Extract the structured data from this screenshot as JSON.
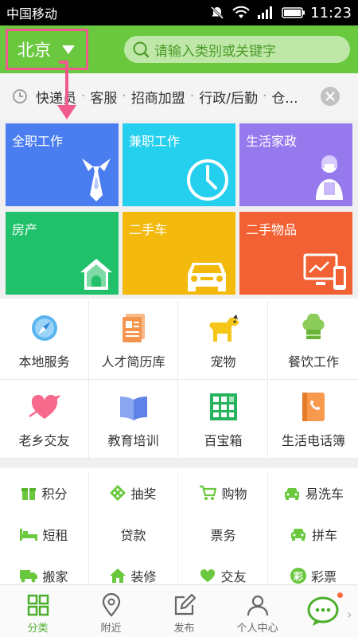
{
  "status": {
    "carrier": "中国移动",
    "time": "11:23"
  },
  "header": {
    "city": "北京",
    "search_placeholder": "请输入类别或关键字"
  },
  "history": {
    "items": [
      "快递员",
      "客服",
      "招商加盟",
      "行政/后勤",
      "仓..."
    ],
    "separator": "·"
  },
  "tiles": [
    {
      "label": "全职工作",
      "color": "#4a7df0",
      "icon": "tie-icon"
    },
    {
      "label": "兼职工作",
      "color": "#25cfee",
      "icon": "clock-icon"
    },
    {
      "label": "生活家政",
      "color": "#9779ee",
      "icon": "maid-icon"
    },
    {
      "label": "房产",
      "color": "#21c16b",
      "icon": "house-icon"
    },
    {
      "label": "二手车",
      "color": "#f3b90d",
      "icon": "car-icon"
    },
    {
      "label": "二手物品",
      "color": "#f26133",
      "icon": "devices-icon"
    }
  ],
  "grid": [
    {
      "label": "本地服务",
      "icon": "compass-icon"
    },
    {
      "label": "人才简历库",
      "icon": "resume-icon"
    },
    {
      "label": "宠物",
      "icon": "dog-icon"
    },
    {
      "label": "餐饮工作",
      "icon": "chef-hat-icon"
    },
    {
      "label": "老乡交友",
      "icon": "heart-arrow-icon"
    },
    {
      "label": "教育培训",
      "icon": "book-icon"
    },
    {
      "label": "百宝箱",
      "icon": "grid-box-icon"
    },
    {
      "label": "生活电话簿",
      "icon": "phonebook-icon"
    }
  ],
  "list": [
    {
      "label": "积分",
      "icon": "gift-icon"
    },
    {
      "label": "抽奖",
      "icon": "lottery-icon"
    },
    {
      "label": "购物",
      "icon": "cart-icon"
    },
    {
      "label": "易洗车",
      "icon": "carwash-icon"
    },
    {
      "label": "短租",
      "icon": "bed-icon"
    },
    {
      "label": "贷款",
      "icon": ""
    },
    {
      "label": "票务",
      "icon": ""
    },
    {
      "label": "拼车",
      "icon": "carpool-icon"
    },
    {
      "label": "搬家",
      "icon": "truck-icon"
    },
    {
      "label": "装修",
      "icon": "home-icon"
    },
    {
      "label": "交友",
      "icon": "heart-icon"
    },
    {
      "label": "彩票",
      "icon": "lottery-ticket-icon"
    }
  ],
  "list_lottery_char": "彩",
  "tabs": [
    {
      "label": "分类",
      "icon": "category-icon",
      "active": true
    },
    {
      "label": "附近",
      "icon": "location-icon",
      "active": false
    },
    {
      "label": "发布",
      "icon": "edit-icon",
      "active": false
    },
    {
      "label": "个人中心",
      "icon": "person-icon",
      "active": false
    }
  ],
  "colors": {
    "brand_green": "#6ac83f",
    "accent_pink": "#f05a8f",
    "tab_active": "#4caf2c"
  }
}
